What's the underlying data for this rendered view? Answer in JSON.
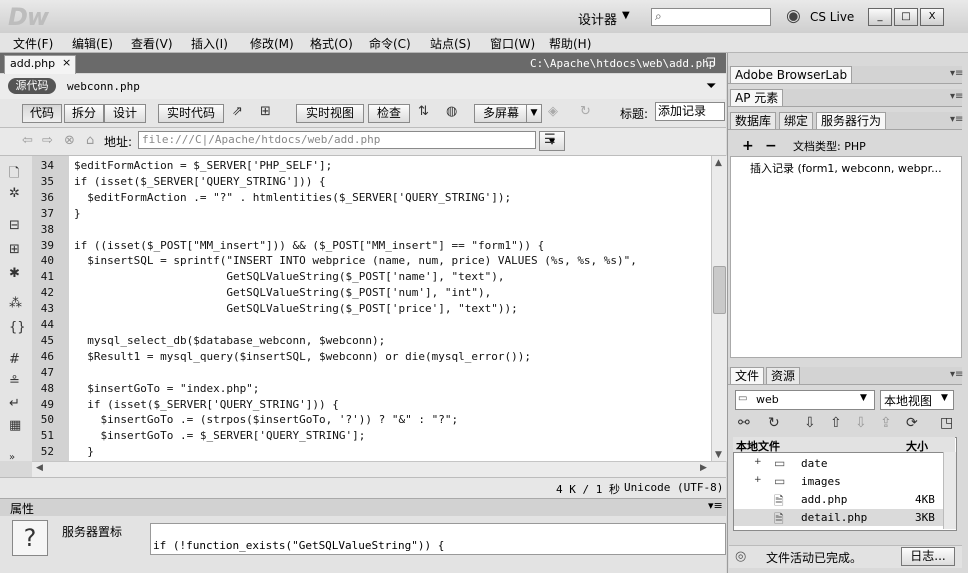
{
  "app": {
    "logo": "Dw",
    "workspace": "设计器",
    "cs_live": "CS Live",
    "window_buttons": [
      "_",
      "□",
      "X"
    ]
  },
  "menu": [
    "文件(F)",
    "编辑(E)",
    "查看(V)",
    "插入(I)",
    "修改(M)",
    "格式(O)",
    "命令(C)",
    "站点(S)",
    "窗口(W)",
    "帮助(H)"
  ],
  "document": {
    "tab_label": "add.php",
    "tab_close": "×",
    "path": "C:\\Apache\\htdocs\\web\\add.php",
    "source_button": "源代码",
    "related_file": "webconn.php"
  },
  "toolbar": {
    "code": "代码",
    "split": "拆分",
    "design": "设计",
    "live_code": "实时代码",
    "live_view": "实时视图",
    "inspect": "检查",
    "multiscreen": "多屏幕",
    "title_label": "标题:",
    "title_value": "添加记录"
  },
  "address": {
    "label": "地址:",
    "value": "file:///C|/Apache/htdocs/web/add.php"
  },
  "code": {
    "lines": [
      {
        "n": "34",
        "t": "$editFormAction = $_SERVER['PHP_SELF'];"
      },
      {
        "n": "35",
        "t": "if (isset($_SERVER['QUERY_STRING'])) {"
      },
      {
        "n": "36",
        "t": "  $editFormAction .= \"?\" . htmlentities($_SERVER['QUERY_STRING']);"
      },
      {
        "n": "37",
        "t": "}"
      },
      {
        "n": "38",
        "t": ""
      },
      {
        "n": "39",
        "t": "if ((isset($_POST[\"MM_insert\"])) && ($_POST[\"MM_insert\"] == \"form1\")) {"
      },
      {
        "n": "40",
        "t": "  $insertSQL = sprintf(\"INSERT INTO webprice (name, num, price) VALUES (%s, %s, %s)\","
      },
      {
        "n": "41",
        "t": "                       GetSQLValueString($_POST['name'], \"text\"),"
      },
      {
        "n": "42",
        "t": "                       GetSQLValueString($_POST['num'], \"int\"),"
      },
      {
        "n": "43",
        "t": "                       GetSQLValueString($_POST['price'], \"text\"));"
      },
      {
        "n": "44",
        "t": ""
      },
      {
        "n": "45",
        "t": "  mysql_select_db($database_webconn, $webconn);"
      },
      {
        "n": "46",
        "t": "  $Result1 = mysql_query($insertSQL, $webconn) or die(mysql_error());"
      },
      {
        "n": "47",
        "t": ""
      },
      {
        "n": "48",
        "t": "  $insertGoTo = \"index.php\";"
      },
      {
        "n": "49",
        "t": "  if (isset($_SERVER['QUERY_STRING'])) {"
      },
      {
        "n": "50",
        "t": "    $insertGoTo .= (strpos($insertGoTo, '?')) ? \"&\" : \"?\";"
      },
      {
        "n": "51",
        "t": "    $insertGoTo .= $_SERVER['QUERY_STRING'];"
      },
      {
        "n": "52",
        "t": "  }"
      }
    ]
  },
  "status": {
    "size": "4 K / 1 秒",
    "encoding": "Unicode (UTF-8)"
  },
  "properties": {
    "title": "属性",
    "icon": "?",
    "label": "服务器置标",
    "code": "if (!function_exists(\"GetSQLValueString\")) {"
  },
  "panels": {
    "browserlab": "Adobe BrowserLab",
    "ap_elements": "AP 元素",
    "tabs": [
      "数据库",
      "绑定",
      "服务器行为"
    ],
    "server_behaviors": {
      "plus": "+",
      "minus": "−",
      "doc_type": "文档类型: PHP",
      "item": "插入记录 (form1, webconn, webpr..."
    },
    "files": {
      "tabs": [
        "文件",
        "资源"
      ],
      "site": "web",
      "view": "本地视图",
      "col_name": "本地文件",
      "col_size": "大小",
      "rows": [
        {
          "expander": "+",
          "icon": "folder",
          "name": "date",
          "size": ""
        },
        {
          "expander": "+",
          "icon": "folder",
          "name": "images",
          "size": ""
        },
        {
          "expander": "",
          "icon": "php-file",
          "name": "add.php",
          "size": "4KB"
        },
        {
          "expander": "",
          "icon": "php-file",
          "name": "detail.php",
          "size": "3KB"
        }
      ],
      "status": "文件活动已完成。",
      "log_button": "日志..."
    }
  },
  "colors": {
    "tab_strip": "#6a6a6a",
    "gutter": "#d2d2d2"
  }
}
